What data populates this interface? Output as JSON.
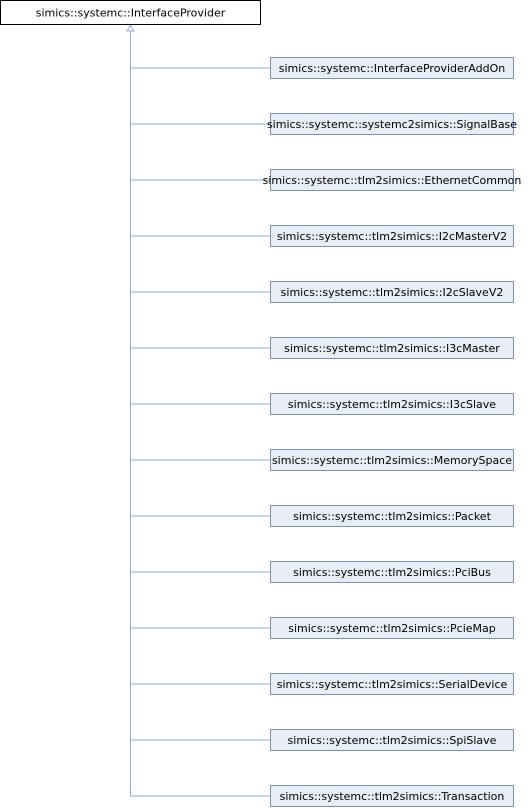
{
  "diagram": {
    "type": "class-inheritance",
    "base": {
      "label": "simics::systemc::InterfaceProvider"
    },
    "derived": [
      {
        "label": "simics::systemc::InterfaceProviderAddOn"
      },
      {
        "label": "simics::systemc::systemc2simics::SignalBase"
      },
      {
        "label": "simics::systemc::tlm2simics::EthernetCommon"
      },
      {
        "label": "simics::systemc::tlm2simics::I2cMasterV2"
      },
      {
        "label": "simics::systemc::tlm2simics::I2cSlaveV2"
      },
      {
        "label": "simics::systemc::tlm2simics::I3cMaster"
      },
      {
        "label": "simics::systemc::tlm2simics::I3cSlave"
      },
      {
        "label": "simics::systemc::tlm2simics::MemorySpace"
      },
      {
        "label": "simics::systemc::tlm2simics::Packet"
      },
      {
        "label": "simics::systemc::tlm2simics::PciBus"
      },
      {
        "label": "simics::systemc::tlm2simics::PcieMap"
      },
      {
        "label": "simics::systemc::tlm2simics::SerialDevice"
      },
      {
        "label": "simics::systemc::tlm2simics::SpiSlave"
      },
      {
        "label": "simics::systemc::tlm2simics::Transaction"
      }
    ],
    "colors": {
      "base_fill": "#ffffff",
      "base_stroke": "#000000",
      "derived_fill": "#e8ecf4",
      "derived_stroke": "#7e8db8",
      "edge": "#8ab0d8"
    }
  }
}
